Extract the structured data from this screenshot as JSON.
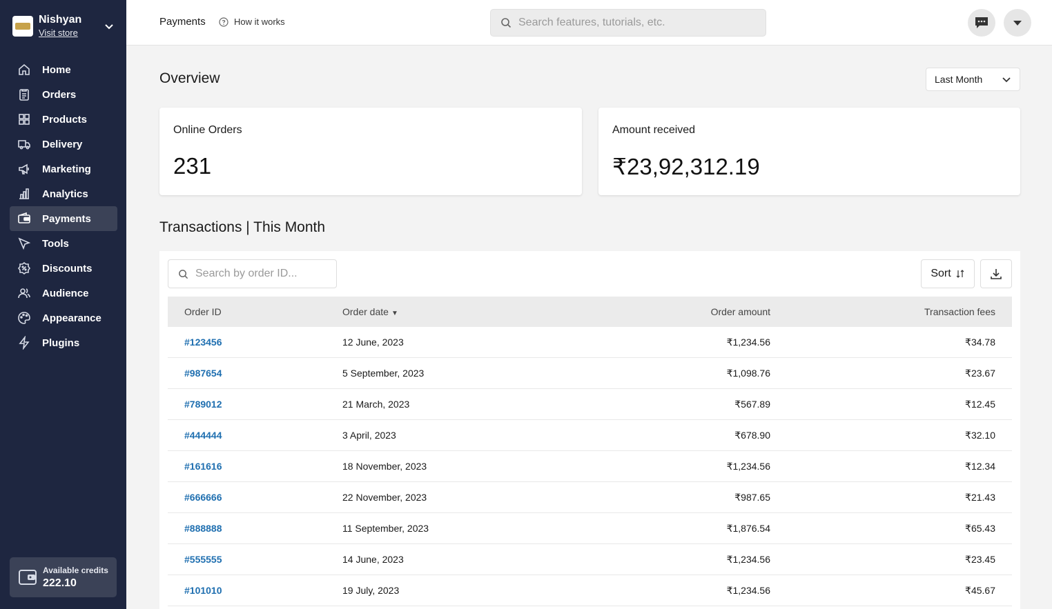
{
  "store": {
    "name": "Nishyan",
    "visit_link": "Visit store"
  },
  "sidebar": {
    "items": [
      {
        "label": "Home",
        "icon": "home-icon"
      },
      {
        "label": "Orders",
        "icon": "orders-icon"
      },
      {
        "label": "Products",
        "icon": "products-icon"
      },
      {
        "label": "Delivery",
        "icon": "truck-icon"
      },
      {
        "label": "Marketing",
        "icon": "megaphone-icon"
      },
      {
        "label": "Analytics",
        "icon": "bar-chart-icon"
      },
      {
        "label": "Payments",
        "icon": "wallet-icon",
        "active": true
      },
      {
        "label": "Tools",
        "icon": "cursor-icon"
      },
      {
        "label": "Discounts",
        "icon": "discount-badge-icon"
      },
      {
        "label": "Audience",
        "icon": "users-icon"
      },
      {
        "label": "Appearance",
        "icon": "palette-icon"
      },
      {
        "label": "Plugins",
        "icon": "lightning-icon"
      }
    ],
    "credits": {
      "label": "Available credits",
      "value": "222.10"
    }
  },
  "header": {
    "title": "Payments",
    "how_it_works": "How it works",
    "search_placeholder": "Search features, tutorials, etc."
  },
  "overview": {
    "title": "Overview",
    "period": "Last Month",
    "cards": [
      {
        "label": "Online Orders",
        "value": "231"
      },
      {
        "label": "Amount received",
        "value": "₹23,92,312.19"
      }
    ]
  },
  "transactions": {
    "title": "Transactions | This Month",
    "search_placeholder": "Search by order ID...",
    "sort_label": "Sort",
    "columns": [
      "Order ID",
      "Order date",
      "Order amount",
      "Transaction fees"
    ],
    "rows": [
      [
        "#123456",
        "12 June, 2023",
        "₹1,234.56",
        "₹34.78"
      ],
      [
        "#987654",
        "5 September, 2023",
        "₹1,098.76",
        "₹23.67"
      ],
      [
        "#789012",
        "21 March, 2023",
        "₹567.89",
        "₹12.45"
      ],
      [
        "#444444",
        "3 April, 2023",
        "₹678.90",
        "₹32.10"
      ],
      [
        "#161616",
        "18 November, 2023",
        "₹1,234.56",
        "₹12.34"
      ],
      [
        "#666666",
        "22 November, 2023",
        "₹987.65",
        "₹21.43"
      ],
      [
        "#888888",
        "11 September, 2023",
        "₹1,876.54",
        "₹65.43"
      ],
      [
        "#555555",
        "14 June, 2023",
        "₹1,234.56",
        "₹23.45"
      ],
      [
        "#101010",
        "19 July, 2023",
        "₹1,234.56",
        "₹45.67"
      ]
    ]
  },
  "colors": {
    "sidebar_bg": "#1e2640",
    "active_item": "#3b4257",
    "link": "#1f6fb0"
  }
}
